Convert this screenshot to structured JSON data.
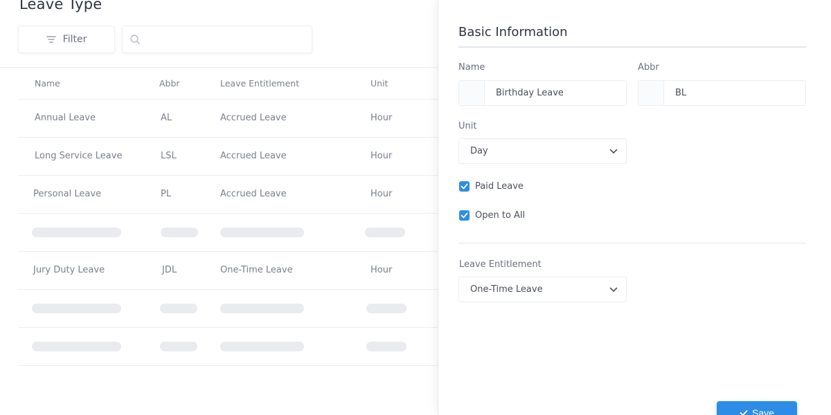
{
  "page": {
    "title": "Leave Type"
  },
  "toolbar": {
    "filter_label": "Filter",
    "search_placeholder": "",
    "search_value": ""
  },
  "table": {
    "headers": [
      "Name",
      "Abbr",
      "Leave Entitlement",
      "Unit"
    ],
    "rows": [
      [
        "Annual Leave",
        "AL",
        "Accrued Leave",
        "Hour"
      ],
      [
        "Long Service Leave",
        "LSL",
        "Accrued Leave",
        "Hour"
      ],
      [
        "Personal Leave",
        "PL",
        "Accrued Leave",
        "Hour"
      ],
      [
        "Jury Duty Leave",
        "JDL",
        "One-Time Leave",
        "Hour"
      ]
    ]
  },
  "panel": {
    "title": "Basic Information",
    "name_label": "Name",
    "name_value": "Birthday Leave",
    "abbr_label": "Abbr",
    "abbr_value": "BL",
    "unit_label": "Unit",
    "unit_value": "Day",
    "paid_leave_label": "Paid Leave",
    "paid_leave_checked": true,
    "open_to_all_label": "Open to All",
    "open_to_all_checked": true,
    "entitlement_label": "Leave Entitlement",
    "entitlement_value": "One-Time Leave",
    "save_label": "Save"
  },
  "colors": {
    "accent": "#2d8de6",
    "placeholder_bar": "#e9ebee",
    "border": "#eceef2"
  },
  "icons": {
    "filter": "filter-lines-icon",
    "search": "magnifier-icon",
    "dropdown": "chevron-down-icon",
    "check": "checkmark-icon"
  }
}
